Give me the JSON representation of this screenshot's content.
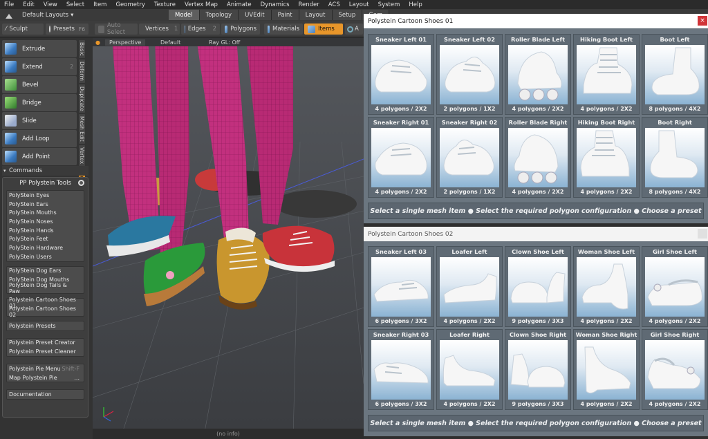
{
  "menu": [
    "File",
    "Edit",
    "View",
    "Select",
    "Item",
    "Geometry",
    "Texture",
    "Vertex Map",
    "Animate",
    "Dynamics",
    "Render",
    "ACS",
    "Layout",
    "System",
    "Help"
  ],
  "layout_selector": "Default Layouts",
  "tabs": [
    "Model",
    "Topology",
    "UVEdit",
    "Paint",
    "Layout",
    "Setup",
    "Gam"
  ],
  "toolbar": {
    "sculpt": "Sculpt",
    "presets": "Presets",
    "presets_key": "F6",
    "auto_select": "Auto Select",
    "vertices": "Vertices",
    "vertices_num": "1",
    "edges": "Edges",
    "edges_num": "2",
    "polygons": "Polygons",
    "materials": "Materials",
    "items": "Items",
    "a": "A"
  },
  "tools": [
    {
      "label": "Extrude",
      "key": ""
    },
    {
      "label": "Extend",
      "key": "2"
    },
    {
      "label": "Bevel",
      "key": ""
    },
    {
      "label": "Bridge",
      "key": ""
    },
    {
      "label": "Slide",
      "key": ""
    },
    {
      "label": "Add Loop",
      "key": ""
    },
    {
      "label": "Add Point",
      "key": ""
    }
  ],
  "vtabs": [
    "Basic",
    "Deform",
    "Duplicate",
    "Mesh Edit",
    "Vertex",
    "Edge"
  ],
  "commands_label": "Commands",
  "pp_title": "PP Polystein Tools",
  "groups": [
    [
      "PolyStein Eyes",
      "PolyStein Ears",
      "PolyStein Mouths",
      "PolyStein Noses",
      "PolyStein Hands",
      "PolyStein Feet",
      "PolyStein Hardware",
      "PolyStein Users"
    ],
    [
      "PolyStein Dog Ears",
      "PolyStein Dog Mouths",
      "PolyStein Dog Tails & Paw"
    ],
    [
      "Polystein Cartoon Shoes 01",
      "Polystein Cartoon Shoes 02"
    ],
    [
      "Polystein Presets"
    ],
    [
      "Polystein Preset Creator",
      "Polystein Preset Cleaner"
    ]
  ],
  "pie": {
    "menu": "Polystein Pie Menu",
    "menu_key": "Shift-F",
    "map": "Map Polystein Pie",
    "map_key": "..."
  },
  "documentation": "Documentation",
  "viewport": {
    "view": "Perspective",
    "shading": "Default",
    "raygl": "Ray GL: Off"
  },
  "status": "(no info)",
  "win1": {
    "title": "Polystein Cartoon Shoes 01",
    "close": "×",
    "items": [
      {
        "name": "Sneaker Left 01",
        "info": "4 polygons / 2X2"
      },
      {
        "name": "Sneaker Left 02",
        "info": "2 polygons / 1X2"
      },
      {
        "name": "Roller Blade Left",
        "info": "4 polygons / 2X2"
      },
      {
        "name": "Hiking Boot Left",
        "info": "4 polygons / 2X2"
      },
      {
        "name": "Boot Left",
        "info": "8 polygons / 4X2"
      },
      {
        "name": "Sneaker Right 01",
        "info": "4 polygons / 2X2"
      },
      {
        "name": "Sneaker Right 02",
        "info": "2 polygons / 1X2"
      },
      {
        "name": "Roller Blade Right",
        "info": "4 polygons / 2X2"
      },
      {
        "name": "Hiking Boot Right",
        "info": "4 polygons / 2X2"
      },
      {
        "name": "Boot Right",
        "info": "8 polygons / 4X2"
      }
    ],
    "footer": "Select a single mesh item  ●  Select the required  polygon configuration  ●  Choose a preset"
  },
  "win2": {
    "title": "Polystein Cartoon Shoes 02",
    "items": [
      {
        "name": "Sneaker Left 03",
        "info": "6 polygons / 3X2"
      },
      {
        "name": "Loafer Left",
        "info": "4 polygons / 2X2"
      },
      {
        "name": "Clown Shoe Left",
        "info": "9 polygons / 3X3"
      },
      {
        "name": "Woman Shoe Left",
        "info": "4 polygons / 2X2"
      },
      {
        "name": "Girl Shoe Left",
        "info": "4 polygons / 2X2"
      },
      {
        "name": "Sneaker Right 03",
        "info": "6 polygons / 3X2"
      },
      {
        "name": "Loafer Right",
        "info": "4 polygons / 2X2"
      },
      {
        "name": "Clown Shoe Right",
        "info": "9 polygons / 3X3"
      },
      {
        "name": "Woman Shoe Right",
        "info": "4 polygons / 2X2"
      },
      {
        "name": "Girl Shoe Right",
        "info": "4 polygons / 2X2"
      }
    ],
    "footer": "Select a single mesh item  ●  Select the required polygon configuration  ●  Choose a preset"
  },
  "colors": {
    "accent": "#e8962a",
    "leg": "#c0307a",
    "close": "#d13438"
  }
}
